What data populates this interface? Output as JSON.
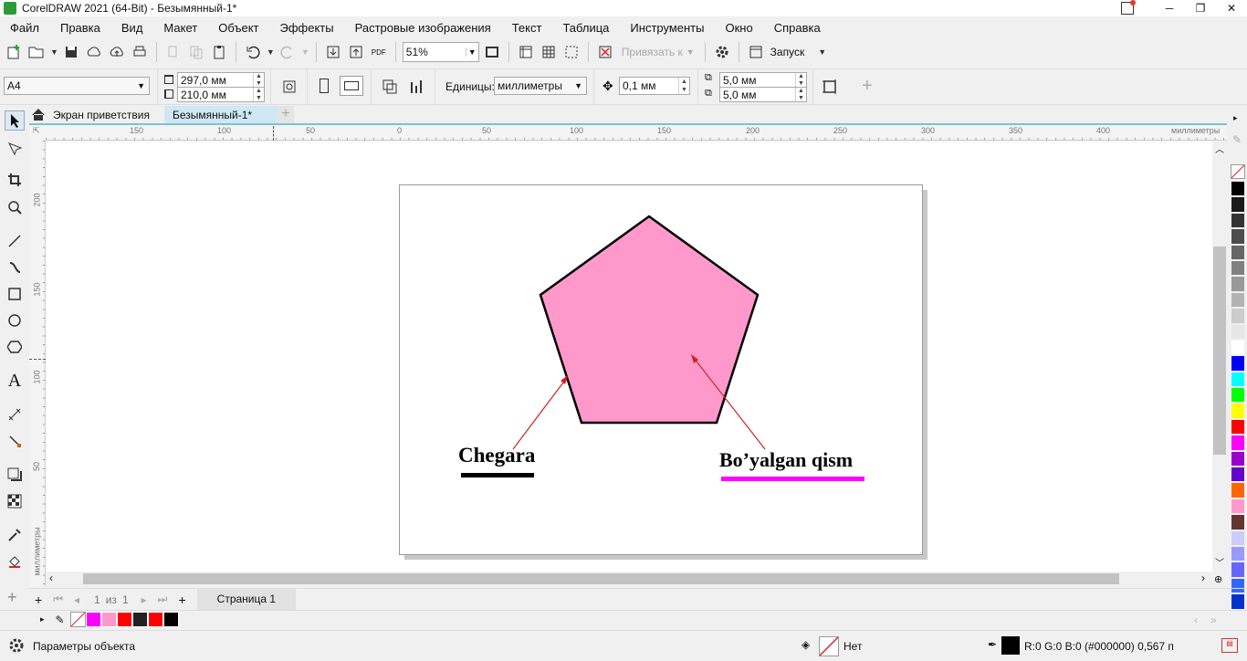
{
  "window": {
    "title": "CorelDRAW 2021 (64-Bit) - Безымянный-1*"
  },
  "menu": [
    "Файл",
    "Правка",
    "Вид",
    "Макет",
    "Объект",
    "Эффекты",
    "Растровые изображения",
    "Текст",
    "Таблица",
    "Инструменты",
    "Окно",
    "Справка"
  ],
  "toolbar": {
    "zoom": "51%",
    "snap_label": "Привязать к",
    "launch_label": "Запуск",
    "pdf_label": "PDF"
  },
  "property_bar": {
    "page_size": "A4",
    "width": "297,0 мм",
    "height": "210,0 мм",
    "units_label": "Единицы:",
    "units": "миллиметры",
    "nudge": "0,1 мм",
    "dup_x": "5,0 мм",
    "dup_y": "5,0 мм"
  },
  "tabs": {
    "welcome": "Экран приветствия",
    "document": "Безымянный-1*"
  },
  "ruler": {
    "h_ticks": [
      "150",
      "100",
      "50",
      "0",
      "50",
      "100",
      "150",
      "200",
      "250",
      "300",
      "350",
      "400"
    ],
    "h_unit": "миллиметры",
    "v_ticks": [
      "200",
      "150",
      "100",
      "50"
    ],
    "v_unit": "миллиметры"
  },
  "canvas": {
    "label_border": "Chegara",
    "label_fill": "Bo’yalgan qism",
    "fill_color": "#ff99cc",
    "border_color": "#000000",
    "underline_fill_color": "#ff00ff",
    "arrow_color": "#cc2222"
  },
  "page_nav": {
    "current": "1",
    "of": "из",
    "total": "1",
    "page_tab": "Страница 1"
  },
  "doc_palette": [
    "#ff00ff",
    "#ff99cc",
    "#ff0000",
    "#222222",
    "#ff0000",
    "#000000"
  ],
  "palette": [
    "#000000",
    "#1a1a1a",
    "#333333",
    "#4d4d4d",
    "#666666",
    "#808080",
    "#999999",
    "#b3b3b3",
    "#cccccc",
    "#e6e6e6",
    "#ffffff",
    "#0000ff",
    "#00ffff",
    "#00ff00",
    "#ffff00",
    "#ff0000",
    "#ff00ff",
    "#9900cc",
    "#6600cc",
    "#ff6600",
    "#ff99cc",
    "#663333",
    "#ccccff",
    "#9999ff",
    "#6666ff",
    "#3366ff",
    "#0033cc"
  ],
  "status": {
    "object_props": "Параметры объекта",
    "fill_none": "Нет",
    "outline": "R:0 G:0 B:0 (#000000)  0,567 п"
  }
}
